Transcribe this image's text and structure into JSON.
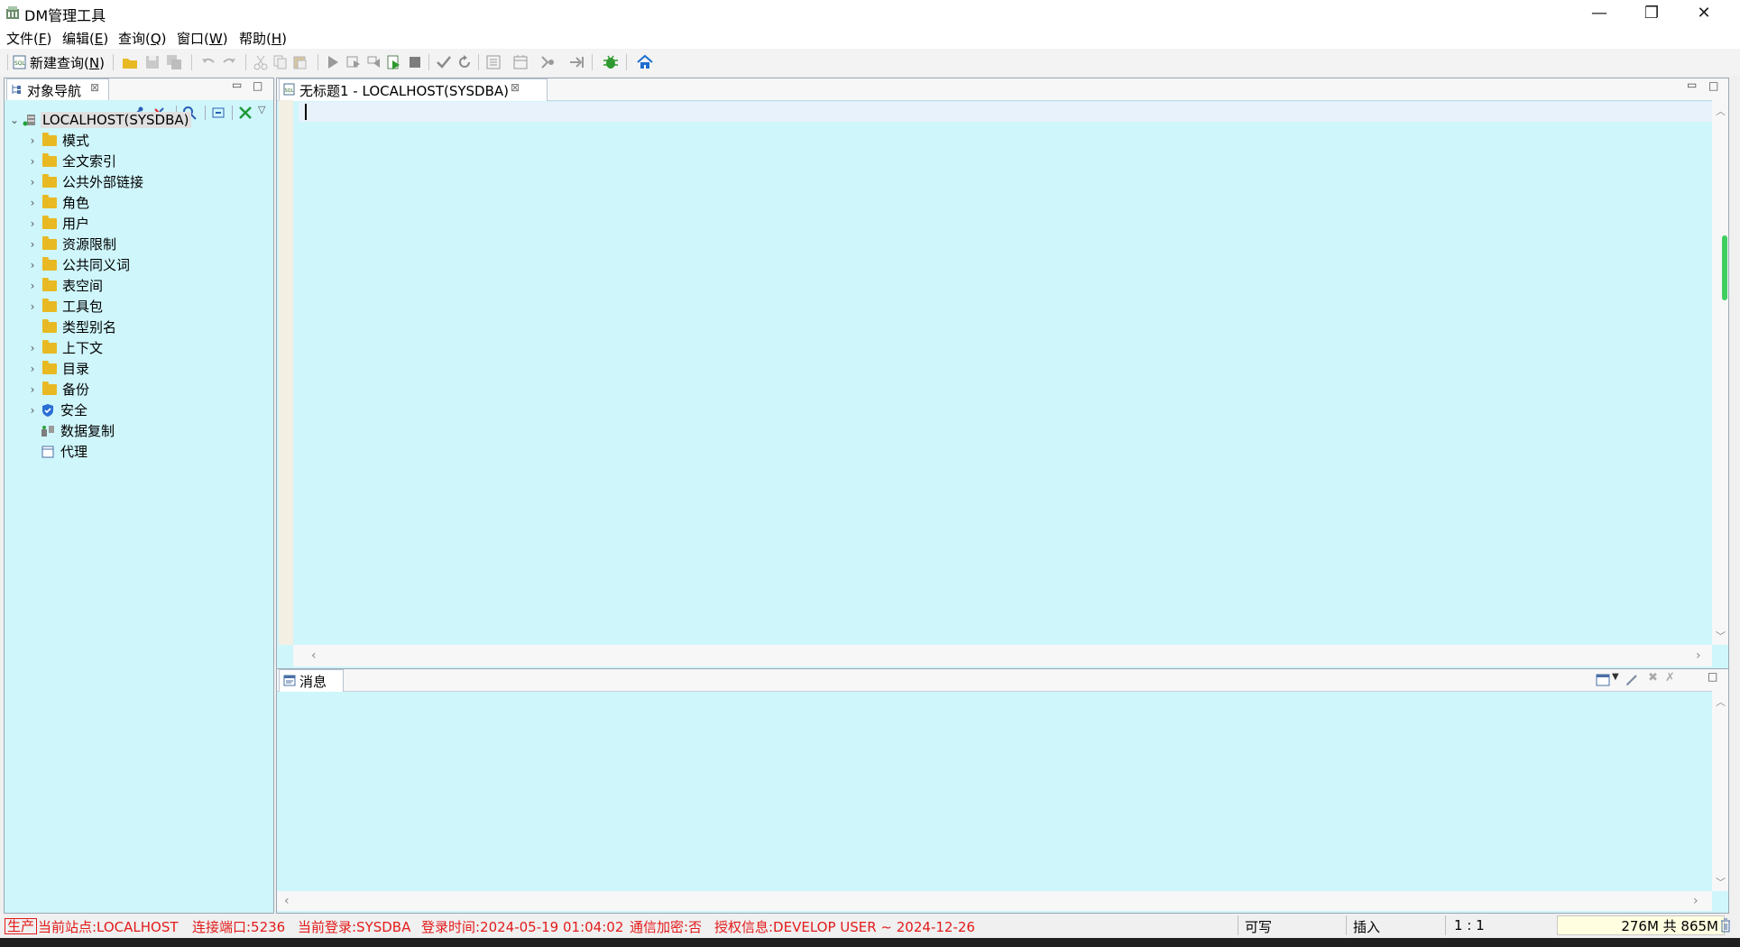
{
  "window": {
    "title": "DM管理工具",
    "controls": [
      "minimize",
      "restore",
      "close"
    ]
  },
  "menu": [
    {
      "label": "文件(",
      "key": "F",
      "end": ")"
    },
    {
      "label": "编辑(",
      "key": "E",
      "end": ")"
    },
    {
      "label": "查询(",
      "key": "Q",
      "end": ")"
    },
    {
      "label": "窗口(",
      "key": "W",
      "end": ")"
    },
    {
      "label": "帮助(",
      "key": "H",
      "end": ")"
    }
  ],
  "toolbar": {
    "new_query_prefix": "新建查询(",
    "new_query_key": "N",
    "new_query_suffix": ")"
  },
  "navigator": {
    "tab_label": "对象导航",
    "root": "LOCALHOST(SYSDBA)",
    "items": [
      {
        "label": "模式",
        "icon": "folder-icon",
        "expandable": true
      },
      {
        "label": "全文索引",
        "icon": "folder-icon",
        "expandable": true
      },
      {
        "label": "公共外部链接",
        "icon": "folder-icon",
        "expandable": true
      },
      {
        "label": "角色",
        "icon": "folder-icon",
        "expandable": true
      },
      {
        "label": "用户",
        "icon": "folder-icon",
        "expandable": true
      },
      {
        "label": "资源限制",
        "icon": "folder-icon",
        "expandable": true
      },
      {
        "label": "公共同义词",
        "icon": "folder-icon",
        "expandable": true
      },
      {
        "label": "表空间",
        "icon": "folder-icon",
        "expandable": true
      },
      {
        "label": "工具包",
        "icon": "folder-icon",
        "expandable": true
      },
      {
        "label": "类型别名",
        "icon": "folder-icon",
        "expandable": false
      },
      {
        "label": "上下文",
        "icon": "folder-icon",
        "expandable": true
      },
      {
        "label": "目录",
        "icon": "folder-icon",
        "expandable": true
      },
      {
        "label": "备份",
        "icon": "folder-icon",
        "expandable": true
      },
      {
        "label": "安全",
        "icon": "shield-icon",
        "expandable": true
      },
      {
        "label": "数据复制",
        "icon": "replication-icon",
        "expandable": false
      },
      {
        "label": "代理",
        "icon": "agent-icon",
        "expandable": false
      }
    ]
  },
  "editor": {
    "tab_label": "无标题1 - LOCALHOST(SYSDBA)",
    "content": ""
  },
  "messages": {
    "tab_label": "消息"
  },
  "status": {
    "env": "生产",
    "site": "当前站点:LOCALHOST",
    "port": "连接端口:5236",
    "login": "当前登录:SYSDBA",
    "login_time": "登录时间:2024-05-19 01:04:02",
    "encryption": "通信加密:否",
    "license": "授权信息:DEVELOP USER ~ 2024-12-26",
    "mode_rw": "可写",
    "mode_insert": "插入",
    "cursor_pos": "1 : 1",
    "memory": "276M 共 865M"
  },
  "colors": {
    "panel_bg": "#cff6fb",
    "status_red": "#e31b1b",
    "folder": "#e8b923"
  }
}
